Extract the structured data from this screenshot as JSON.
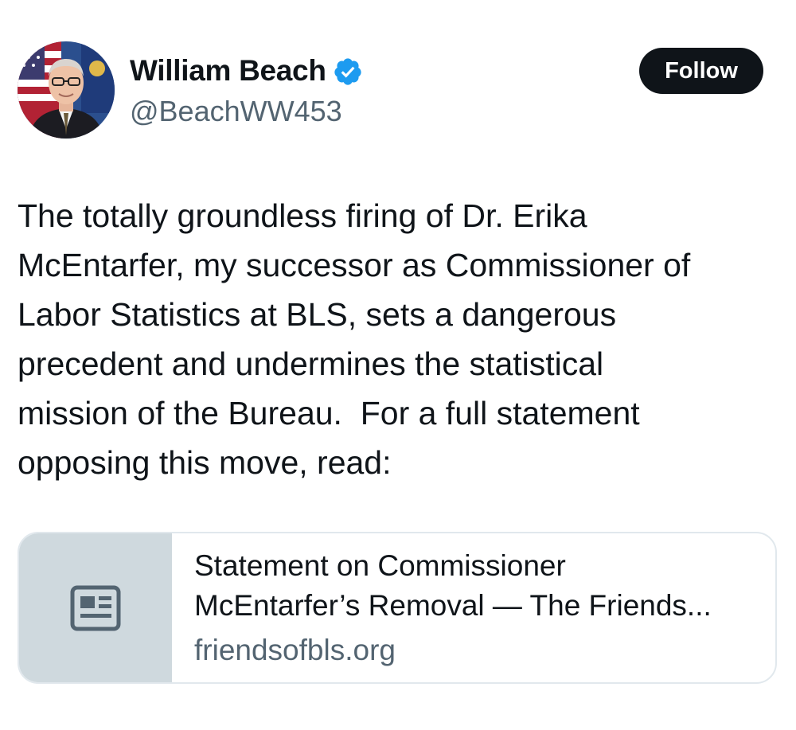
{
  "author": {
    "display_name": "William Beach",
    "handle": "@BeachWW453",
    "verified": true,
    "avatar_icon": "profile-photo"
  },
  "follow_button": {
    "label": "Follow"
  },
  "tweet": {
    "text": "The totally groundless firing of Dr. Erika\nMcEntarfer, my successor as Commissioner of\nLabor Statistics at BLS, sets a dangerous\nprecedent and undermines the statistical\nmission of the Bureau.  For a full statement\nopposing this move, read:"
  },
  "link_card": {
    "title_line1": "Statement on Commissioner",
    "title_line2": "McEntarfer’s Removal — The Friends...",
    "domain": "friendsofbls.org",
    "thumb_icon": "article-icon"
  },
  "colors": {
    "text_primary": "#0f1419",
    "text_secondary": "#536471",
    "verified_blue": "#1d9bf0",
    "button_bg": "#0f1419",
    "card_thumb_bg": "#cfd9de",
    "card_border": "#e1e8ed"
  }
}
